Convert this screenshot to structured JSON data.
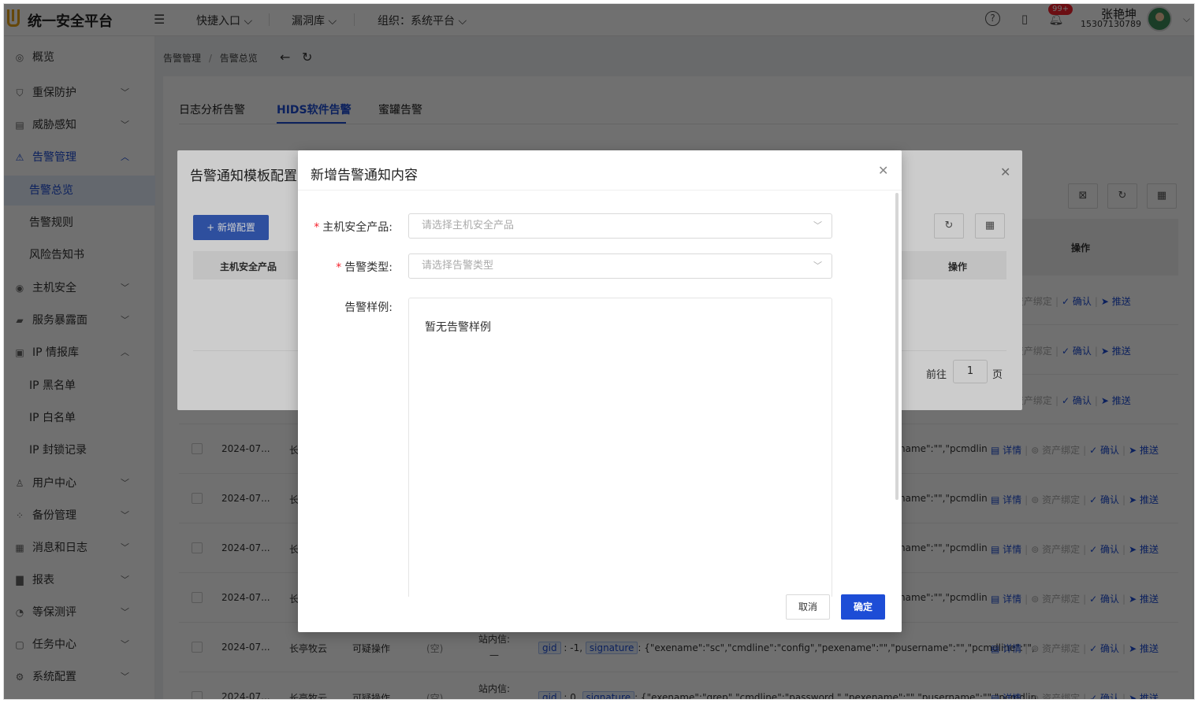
{
  "header": {
    "app_title": "统一安全平台",
    "nav": [
      "快捷入口",
      "漏洞库",
      "组织：系统平台"
    ],
    "notification_count": "99+",
    "user_name": "张艳坤",
    "user_phone": "15307130789"
  },
  "sidebar": {
    "items": [
      {
        "label": "概览",
        "icon": "dashboard-icon"
      },
      {
        "label": "重保防护",
        "icon": "shield-icon"
      },
      {
        "label": "威胁感知",
        "icon": "server-icon"
      },
      {
        "label": "告警管理",
        "icon": "warning-icon"
      },
      {
        "label": "告警总览"
      },
      {
        "label": "告警规则"
      },
      {
        "label": "风险告知书"
      },
      {
        "label": "主机安全",
        "icon": "eye-icon"
      },
      {
        "label": "服务暴露面",
        "icon": "lock-icon"
      },
      {
        "label": "IP 情报库",
        "icon": "ip-icon"
      },
      {
        "label": "IP 黑名单"
      },
      {
        "label": "IP 白名单"
      },
      {
        "label": "IP 封锁记录"
      },
      {
        "label": "用户中心",
        "icon": "user-icon"
      },
      {
        "label": "备份管理",
        "icon": "backup-icon"
      },
      {
        "label": "消息和日志",
        "icon": "log-icon"
      },
      {
        "label": "报表",
        "icon": "report-icon"
      },
      {
        "label": "等保测评",
        "icon": "gauge-icon"
      },
      {
        "label": "任务中心",
        "icon": "task-icon"
      },
      {
        "label": "系统配置",
        "icon": "settings-icon"
      }
    ]
  },
  "breadcrumb": [
    "告警管理",
    "/",
    "告警总览"
  ],
  "tabs": [
    "日志分析告警",
    "HIDS软件告警",
    "蜜罐告警"
  ],
  "table": {
    "op_header": "操作",
    "rows": [
      {
        "date": "2024-07...",
        "org": "长"
      },
      {
        "date": "2024-07...",
        "org": "长"
      },
      {
        "date": "2024-07...",
        "org": "长"
      },
      {
        "date": "2024-07...",
        "org": "长"
      },
      {
        "date": "2024-07...",
        "org": "长亭牧云",
        "type": "可疑操作",
        "status": "(空)",
        "channel": "站内信:",
        "channel2": "—",
        "gid": "gid",
        "gidval": ": -1,",
        "sig": "signature",
        "detail": ": {\"exename\":\"sc\",\"cmdline\":\"config\",\"pexename\":\"\",\"pusername\":\"\",\"pcmdline\":\"\","
      },
      {
        "date": "2024-07...",
        "org": "长亭牧云",
        "type": "可疑操作",
        "status": "(空)",
        "channel": "站内信:",
        "gid": "gid",
        "gidval": ": 0,",
        "sig": "signature",
        "detail": ": {\"exename\":\"grep\",\"cmdline\":\"password \",\"pexename\":\"\",\"pusername\":\"\",\"pcmdlin"
      }
    ],
    "trunc_text": "name\":\"\",\"pcmdlin",
    "ops": {
      "detail": "详情",
      "bind": "资产绑定",
      "confirm": "确认",
      "push": "推送"
    }
  },
  "dialog_template": {
    "title": "告警通知模板配置",
    "add_button": "+ 新增配置",
    "col_product": "主机安全产品",
    "col_op": "操作",
    "goto_label": "前往",
    "goto_value": "1",
    "page_label": "页"
  },
  "dialog_add": {
    "title": "新增告警通知内容",
    "product_label": "主机安全产品:",
    "product_placeholder": "请选择主机安全产品",
    "type_label": "告警类型:",
    "type_placeholder": "请选择告警类型",
    "sample_label": "告警样例:",
    "sample_text": "暂无告警样例",
    "cancel": "取消",
    "ok": "确定"
  }
}
